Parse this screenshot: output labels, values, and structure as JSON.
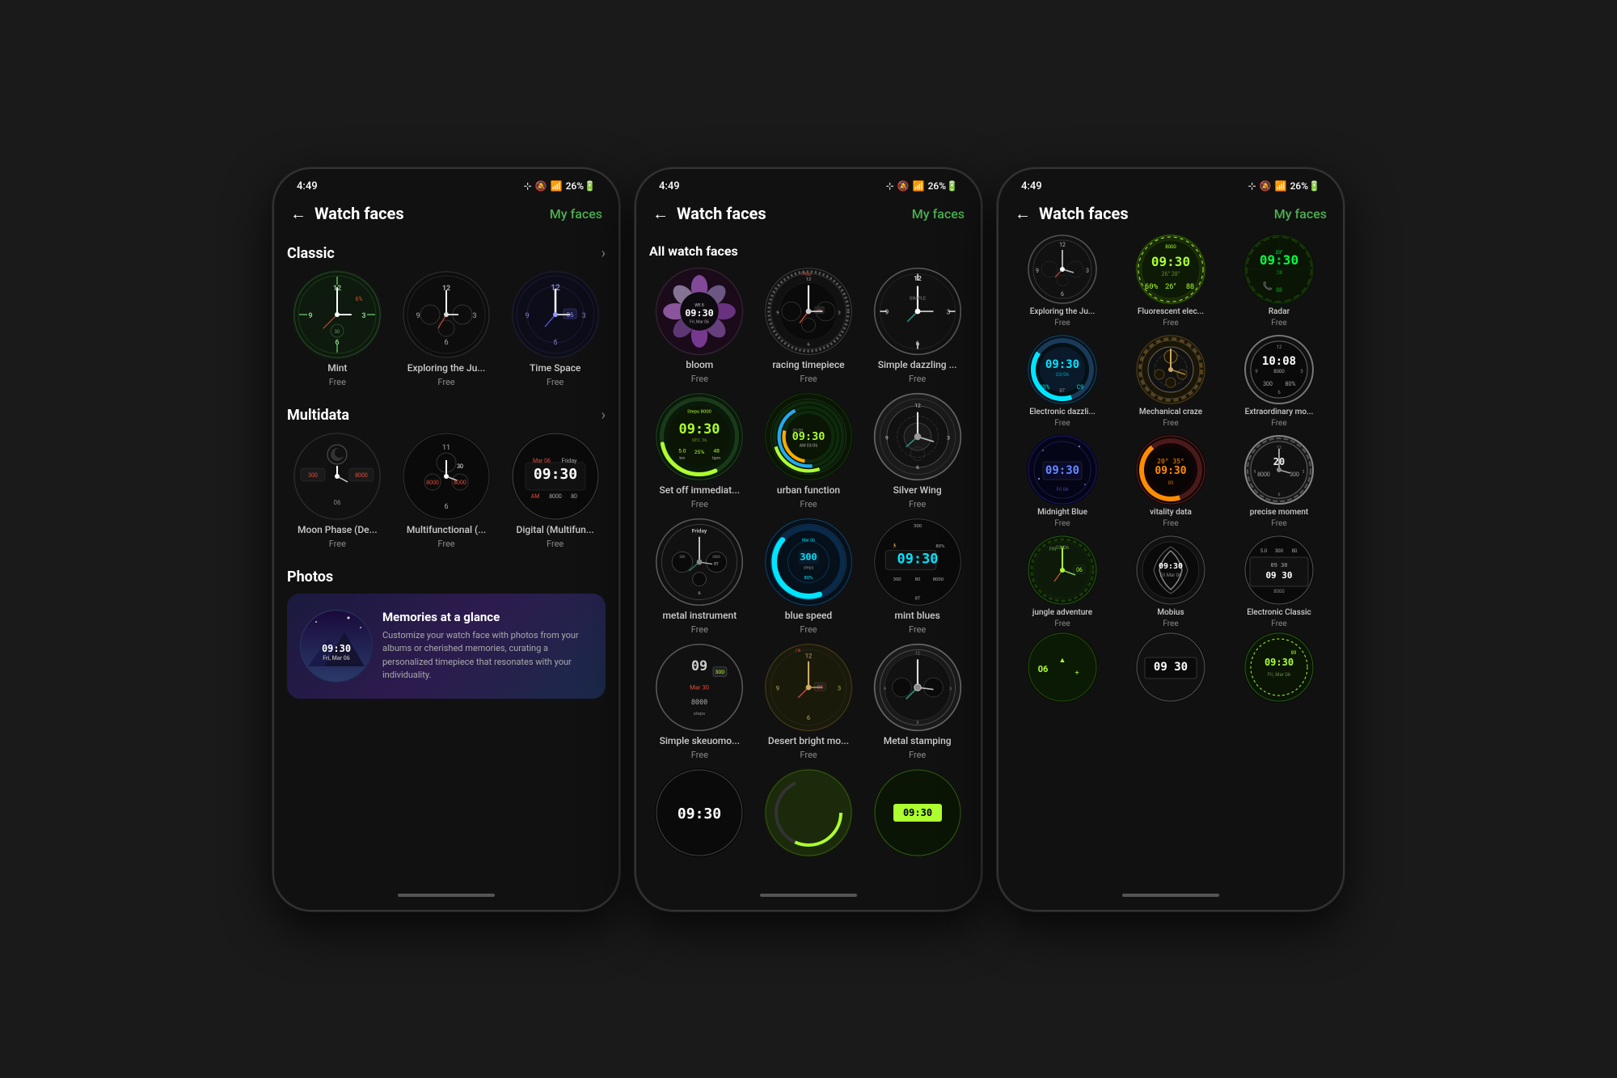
{
  "phones": [
    {
      "id": "phone1",
      "status": {
        "time": "4:49",
        "icons": "⊹ 🔇 📶 26%🔋"
      },
      "header": {
        "title": "Watch faces",
        "myFaces": "My faces"
      },
      "sections": [
        {
          "name": "Classic",
          "items": [
            {
              "name": "Mint",
              "price": "Free",
              "style": "mint"
            },
            {
              "name": "Exploring the Ju...",
              "price": "Free",
              "style": "exploring"
            },
            {
              "name": "Time Space",
              "price": "Free",
              "style": "timespace"
            }
          ]
        },
        {
          "name": "Multidata",
          "items": [
            {
              "name": "Moon Phase (De...",
              "price": "Free",
              "style": "moonphase"
            },
            {
              "name": "Multifunctional (...",
              "price": "Free",
              "style": "multifunc"
            },
            {
              "name": "Digital (Multifun...",
              "price": "Free",
              "style": "digital"
            }
          ]
        },
        {
          "name": "Photos",
          "banner": {
            "title": "Memories at a glance",
            "description": "Customize your watch face with photos from your albums or cherished memories, curating a personalized timepiece that resonates with your individuality."
          }
        }
      ]
    },
    {
      "id": "phone2",
      "status": {
        "time": "4:49",
        "icons": "⊹ 🔇 📶 26%🔋"
      },
      "header": {
        "title": "Watch faces",
        "myFaces": "My faces"
      },
      "sectionLabel": "All watch faces",
      "items": [
        {
          "name": "bloom",
          "price": "Free",
          "style": "bloom"
        },
        {
          "name": "racing timepiece",
          "price": "Free",
          "style": "racing"
        },
        {
          "name": "Simple dazzling ...",
          "price": "Free",
          "style": "simple-dazzle"
        },
        {
          "name": "Set off immediat...",
          "price": "Free",
          "style": "set-off"
        },
        {
          "name": "urban function",
          "price": "Free",
          "style": "urban"
        },
        {
          "name": "Silver Wing",
          "price": "Free",
          "style": "silver"
        },
        {
          "name": "metal instrument",
          "price": "Free",
          "style": "metal"
        },
        {
          "name": "blue speed",
          "price": "Free",
          "style": "blue-speed"
        },
        {
          "name": "mint blues",
          "price": "Free",
          "style": "mint-blues"
        },
        {
          "name": "Simple skeuomo...",
          "price": "Free",
          "style": "simple-sk"
        },
        {
          "name": "Desert bright mo...",
          "price": "Free",
          "style": "desert"
        },
        {
          "name": "Metal stamping",
          "price": "Free",
          "style": "metal-stamp"
        }
      ]
    },
    {
      "id": "phone3",
      "status": {
        "time": "4:49",
        "icons": "⊹ 🔇 📶 26%🔋"
      },
      "header": {
        "title": "Watch faces",
        "myFaces": "My faces"
      },
      "items": [
        {
          "name": "Exploring the Ju...",
          "price": "Free",
          "style": "exploring-ju"
        },
        {
          "name": "Fluorescent elec...",
          "price": "Free",
          "style": "fluorescent"
        },
        {
          "name": "Radar",
          "price": "Free",
          "style": "radar"
        },
        {
          "name": "Electronic dazzli...",
          "price": "Free",
          "style": "elec-dazzle"
        },
        {
          "name": "Mechanical craze",
          "price": "Free",
          "style": "mech-craze"
        },
        {
          "name": "Extraordinary mo...",
          "price": "Free",
          "style": "extraordinary"
        },
        {
          "name": "Midnight Blue",
          "price": "Free",
          "style": "midnight"
        },
        {
          "name": "vitality data",
          "price": "Free",
          "style": "vitality"
        },
        {
          "name": "precise moment",
          "price": "Free",
          "style": "precise"
        },
        {
          "name": "jungle adventure",
          "price": "Free",
          "style": "jungle"
        },
        {
          "name": "Mobius",
          "price": "Free",
          "style": "mobius"
        },
        {
          "name": "Electronic Classic",
          "price": "Free",
          "style": "elec-classic"
        }
      ]
    }
  ]
}
